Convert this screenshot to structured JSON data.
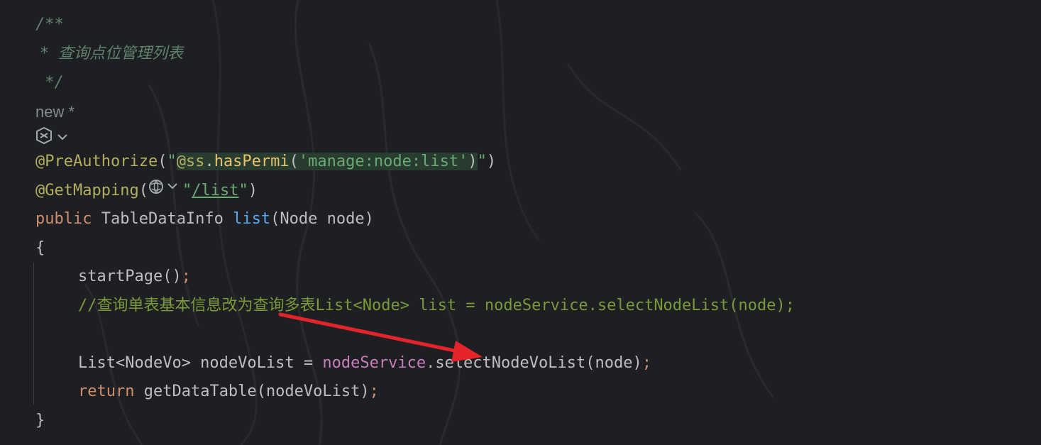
{
  "doc_comment": {
    "open": "/**",
    "body": " *  查询点位管理列表",
    "close": " */"
  },
  "inlay_hint": {
    "label": "new *"
  },
  "ai_actions": {
    "icon": "ai-assistant-icon",
    "chevron": "chevron-down-icon"
  },
  "code": {
    "preauthorize": {
      "annotation": "@PreAuthorize",
      "paren_open": "(",
      "quote_open": "\"",
      "at_ss": "@ss",
      "dot": ".",
      "method": "hasPermi",
      "inner_open": "(",
      "permission": "'manage:node:list'",
      "inner_close": ")",
      "quote_close": "\"",
      "paren_close": ")"
    },
    "getmapping": {
      "annotation": "@GetMapping",
      "paren_open": "(",
      "globe_icon": "globe-icon",
      "quote_open": "\"",
      "path": "/list",
      "quote_close": "\"",
      "paren_close": ")"
    },
    "signature": {
      "modifier": "public",
      "return_type": " TableDataInfo ",
      "method_name": "list",
      "params": "(Node node)"
    },
    "open_brace": "{",
    "start_page": {
      "call": "startPage()",
      "semicolon": ";"
    },
    "line_comment": "//查询单表基本信息改为查询多表List<Node> list = nodeService.selectNodeList(node);",
    "nodevo_line": {
      "type_decl": "List<NodeVo> nodeVoList = ",
      "field": "nodeService",
      "call": ".selectNodeVoList(node)",
      "semicolon": ";"
    },
    "return_line": {
      "keyword": "return",
      "expr": " getDataTable(nodeVoList)",
      "semicolon": ";"
    },
    "close_brace": "}"
  },
  "colors": {
    "background": "#1e1f22",
    "annotation": "#b3ae60",
    "string": "#6aab73",
    "keyword": "#cf8e6d",
    "function": "#56a8f5",
    "field": "#c77dbb",
    "doc_comment": "#5f826b",
    "arrow": "#e3242b"
  },
  "overlay": {
    "arrow": "red-arrow-annotation"
  }
}
